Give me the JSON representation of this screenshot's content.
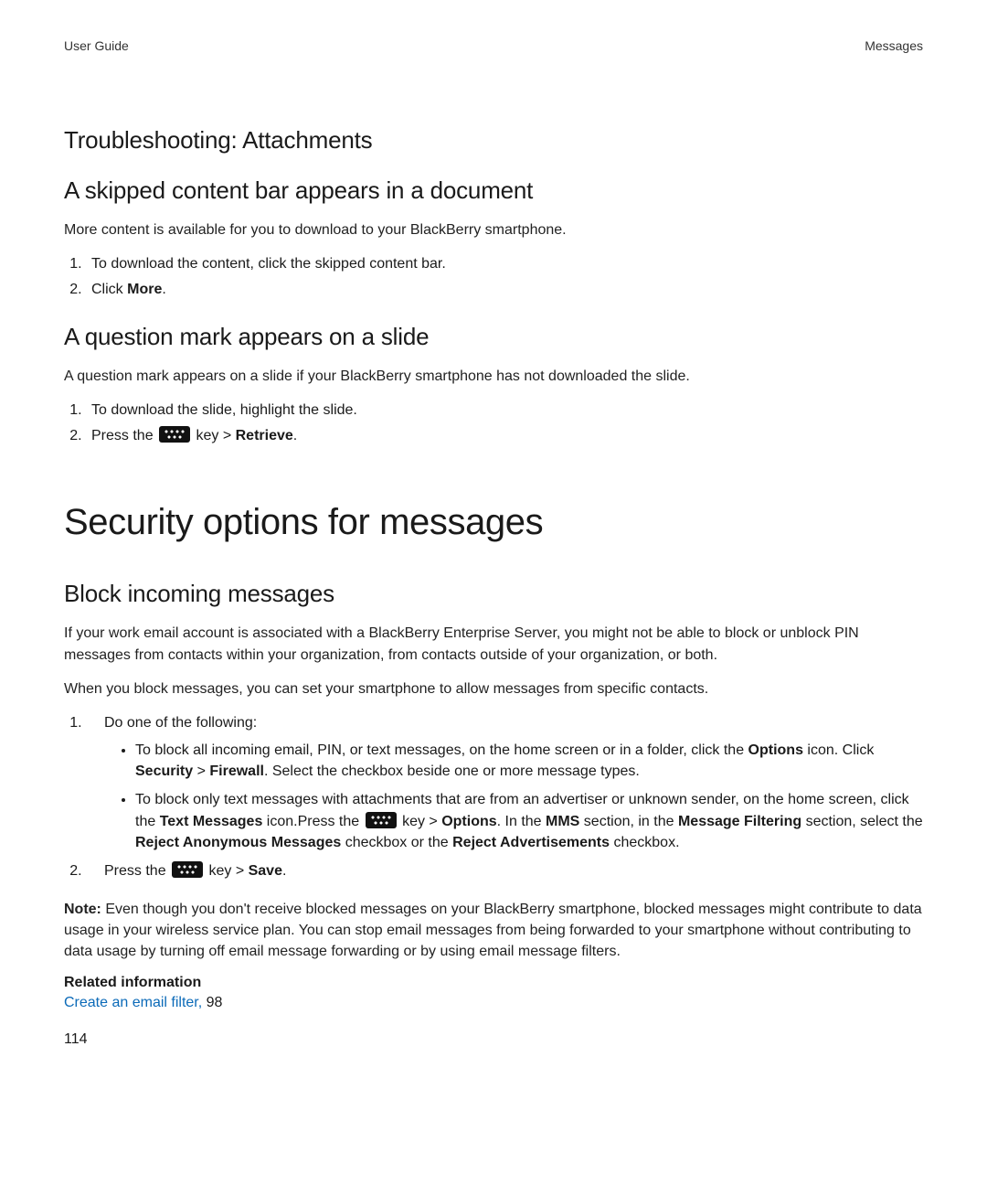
{
  "header": {
    "left": "User Guide",
    "right": "Messages"
  },
  "sec_troubleshoot": {
    "title": "Troubleshooting: Attachments",
    "skipped": {
      "title": "A skipped content bar appears in a document",
      "intro": "More content is available for you to download to your BlackBerry smartphone.",
      "step1": "To download the content, click the skipped content bar.",
      "step2_pre": "Click ",
      "step2_bold": "More",
      "step2_post": "."
    },
    "question": {
      "title": "A question mark appears on a slide",
      "intro": "A question mark appears on a slide if your BlackBerry smartphone has not downloaded the slide.",
      "step1": "To download the slide, highlight the slide.",
      "step2_pre": "Press the ",
      "step2_mid": " key > ",
      "step2_bold": "Retrieve",
      "step2_post": "."
    }
  },
  "sec_security": {
    "title": "Security options for messages",
    "block": {
      "title": "Block incoming messages",
      "para1": "If your work email account is associated with a BlackBerry Enterprise Server, you might not be able to block or unblock PIN messages from contacts within your organization, from contacts outside of your organization, or both.",
      "para2": "When you block messages, you can set your smartphone to allow messages from specific contacts.",
      "step1": "Do one of the following:",
      "b1": {
        "t1": "To block all incoming email, PIN, or text messages, on the home screen or in a folder, click the ",
        "b1": "Options",
        "t2": " icon. Click ",
        "b2": "Security",
        "t3": " > ",
        "b3": "Firewall",
        "t4": ". Select the checkbox beside one or more message types."
      },
      "b2": {
        "t1": "To block only text messages with attachments that are from an advertiser or unknown sender, on the home screen, click the ",
        "b1": "Text Messages",
        "t2": " icon.Press the ",
        "t3": " key > ",
        "b2": "Options",
        "t4": ". In the ",
        "b3": "MMS",
        "t5": " section, in the ",
        "b4": "Message Filtering",
        "t6": " section, select the ",
        "b5": "Reject Anonymous Messages",
        "t7": " checkbox or the ",
        "b6": "Reject Advertisements",
        "t8": " checkbox."
      },
      "step2_pre": "Press the ",
      "step2_mid": " key > ",
      "step2_bold": "Save",
      "step2_post": ".",
      "note_label": "Note:",
      "note_body": " Even though you don't receive blocked messages on your BlackBerry smartphone, blocked messages might contribute to data usage in your wireless service plan. You can stop email messages from being forwarded to your smartphone without contributing to data usage by turning off email message forwarding or by using email message filters.",
      "related_heading": "Related information",
      "related_link": "Create an email filter,",
      "related_page": " 98"
    }
  },
  "page_number": "114"
}
